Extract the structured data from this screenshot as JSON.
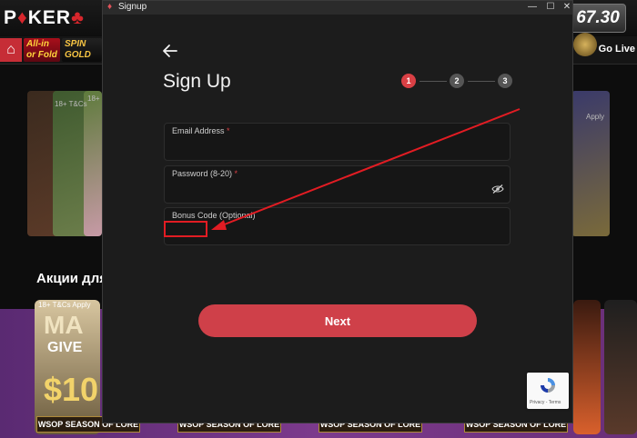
{
  "background": {
    "logo_prefix": "P",
    "logo_mark": "♦",
    "logo_suffix": "KER",
    "logo_tail": "♣",
    "balance": "67.30",
    "home_icon": "⌂",
    "games": [
      {
        "label": "All-in or Fold"
      },
      {
        "label": "SPIN GOLD"
      }
    ],
    "go_live": "Go Live",
    "tc_label_top": "18+ T&Cs",
    "tc_label_mid": "18+",
    "tc_label_right": "Apply",
    "tc_label_promo": "18+ T&Cs Apply",
    "promo_heading": "Акции для",
    "promo_tile_big": "MA",
    "promo_tile_mid": "GIVE",
    "promo_tile_num": "$10",
    "wsop_banner": "WSOP SEASON OF LORE",
    "colors": {
      "brand_red": "#d7262c",
      "promo_purple": "#7c3a8c"
    }
  },
  "window": {
    "title": "Signup",
    "icon": "signup-app-icon",
    "controls": {
      "minimize": "—",
      "maximize": "☐",
      "close": "✕"
    }
  },
  "dialog": {
    "back_icon": "arrow-left-icon",
    "heading": "Sign Up",
    "steps": [
      "1",
      "2",
      "3"
    ],
    "active_step": 1,
    "fields": {
      "email": {
        "label": "Email Address",
        "required_mark": "*",
        "value": ""
      },
      "password": {
        "label": "Password (8-20)",
        "required_mark": "*",
        "value": "",
        "toggle_icon": "eye-slash-icon"
      },
      "bonus": {
        "label": "Bonus Code (Optional)",
        "value": ""
      }
    },
    "next_label": "Next"
  },
  "annotation": {
    "color": "#e21c23"
  },
  "recaptcha": {
    "links": "Privacy - Terms",
    "icon": "recaptcha-icon"
  },
  "colors": {
    "accent": "#cf4049",
    "dialog_bg": "#1c1c1c",
    "step_active": "#d94045",
    "step_inactive": "#555555"
  }
}
